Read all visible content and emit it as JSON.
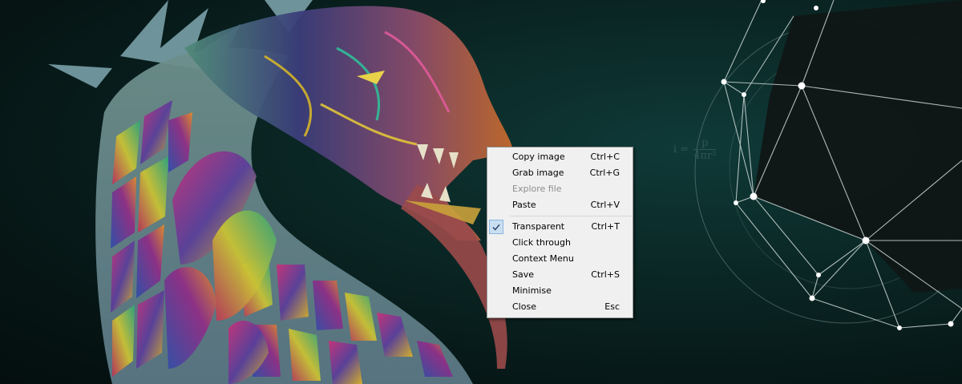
{
  "background": {
    "colors": {
      "base": "#061615",
      "glow": "#0f3a38",
      "mesh_line": "#c9d6d4",
      "dark_polygon": "#101716"
    },
    "formula": {
      "prefix": "i =",
      "numerator": "p",
      "denominator": "4πr²"
    },
    "dragon_artwork": "dragon-illustration",
    "geometry_artwork": "polyhedron-wireframe"
  },
  "context_menu": {
    "items": [
      {
        "label": "Copy image",
        "shortcut": "Ctrl+C",
        "enabled": true,
        "checked": false
      },
      {
        "label": "Grab image",
        "shortcut": "Ctrl+G",
        "enabled": true,
        "checked": false
      },
      {
        "label": "Explore file",
        "shortcut": "",
        "enabled": false,
        "checked": false
      },
      {
        "label": "Paste",
        "shortcut": "Ctrl+V",
        "enabled": true,
        "checked": false
      },
      {
        "separator": true
      },
      {
        "label": "Transparent",
        "shortcut": "Ctrl+T",
        "enabled": true,
        "checked": true
      },
      {
        "label": "Click through",
        "shortcut": "",
        "enabled": true,
        "checked": false
      },
      {
        "label": "Context Menu",
        "shortcut": "",
        "enabled": true,
        "checked": false
      },
      {
        "label": "Save",
        "shortcut": "Ctrl+S",
        "enabled": true,
        "checked": false
      },
      {
        "label": "Minimise",
        "shortcut": "",
        "enabled": true,
        "checked": false
      },
      {
        "label": "Close",
        "shortcut": "Esc",
        "enabled": true,
        "checked": false
      }
    ],
    "check_icon": "checkmark-icon",
    "colors": {
      "background": "#f0f0f0",
      "border": "#979797",
      "disabled_text": "#8d8d8d",
      "check_highlight": "#c9dff1"
    }
  }
}
